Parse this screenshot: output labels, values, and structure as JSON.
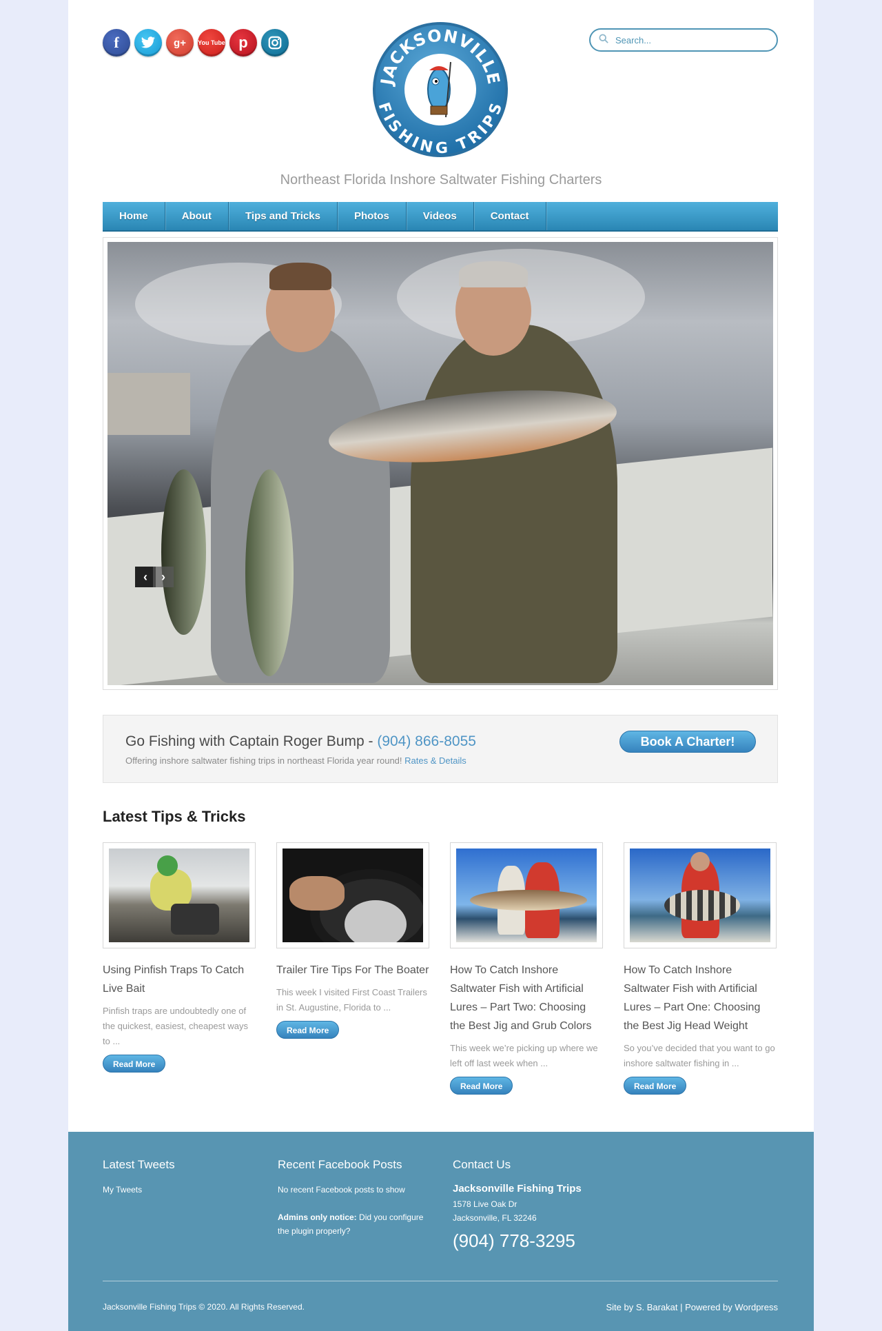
{
  "social": [
    {
      "name": "facebook",
      "glyph": "f"
    },
    {
      "name": "twitter",
      "glyph": "t"
    },
    {
      "name": "google-plus",
      "glyph": "g+"
    },
    {
      "name": "youtube",
      "glyph": "You Tube"
    },
    {
      "name": "pinterest",
      "glyph": "p"
    },
    {
      "name": "instagram",
      "glyph": "◙"
    }
  ],
  "logo": {
    "top_text": "JACKSONVILLE",
    "bottom_text": "FISHING TRIPS"
  },
  "search": {
    "placeholder": "Search..."
  },
  "tagline": "Northeast Florida Inshore Saltwater Fishing Charters",
  "nav": [
    "Home",
    "About",
    "Tips and Tricks",
    "Photos",
    "Videos",
    "Contact"
  ],
  "slider": {
    "prev": "‹",
    "next": "›"
  },
  "cta": {
    "title": "Go Fishing with Captain Roger Bump - ",
    "phone": "(904) 866-8055",
    "subtitle": "Offering inshore saltwater fishing trips in northeast Florida year round! ",
    "link": "Rates & Details",
    "button": "Book A Charter!"
  },
  "latest_title": "Latest Tips & Tricks",
  "posts": [
    {
      "title": "Using Pinfish Traps To Catch Live Bait",
      "excerpt": "Pinfish traps are undoubtedly one of the quickest, easiest, cheapest ways to ...",
      "button": "Read More"
    },
    {
      "title": "Trailer Tire Tips For The Boater",
      "excerpt": "This week I visited First Coast Trailers in St. Augustine, Florida to ...",
      "button": "Read More"
    },
    {
      "title": "How To Catch Inshore Saltwater Fish with Artificial Lures – Part Two: Choosing the Best Jig and Grub Colors",
      "excerpt": "This week we’re picking up where we left off last week when ...",
      "button": "Read More"
    },
    {
      "title": "How To Catch Inshore Saltwater Fish with Artificial Lures – Part One: Choosing the Best Jig Head Weight",
      "excerpt": "So you’ve decided that you want to go inshore saltwater fishing in ...",
      "button": "Read More"
    }
  ],
  "footer": {
    "tweets_title": "Latest Tweets",
    "tweets_link": "My Tweets",
    "fb_title": "Recent Facebook Posts",
    "fb_none": "No recent Facebook posts to show",
    "fb_notice_strong": "Admins only notice:",
    "fb_notice": " Did you configure the plugin properly?",
    "contact_title": "Contact Us",
    "company": "Jacksonville Fishing Trips",
    "address1": "1578 Live Oak Dr",
    "address2": "Jacksonville, FL 32246",
    "phone": "(904) 778-3295",
    "copyright": "Jacksonville Fishing Trips © 2020. All Rights Reserved.",
    "credit": "Site by S. Barakat | Powered by Wordpress"
  },
  "colors": {
    "accent": "#4f95c5",
    "nav": "#2a86b4",
    "footer": "#5895b2",
    "page_bg": "#e8ecfa"
  }
}
